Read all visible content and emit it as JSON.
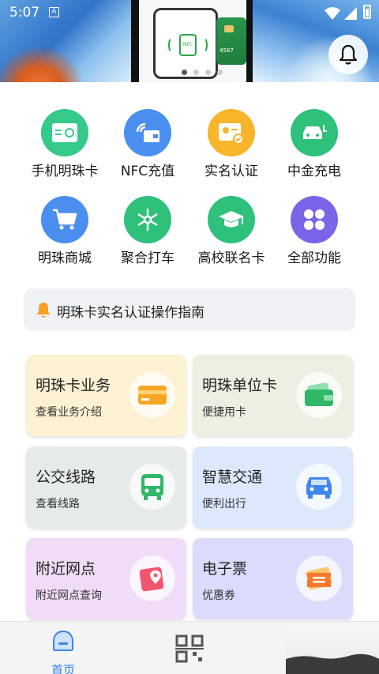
{
  "status_bar": {
    "time": "5:07",
    "badge": "A"
  },
  "banner": {
    "nfc_label": "NFC",
    "card_number": "4587",
    "page_count": 4,
    "active_page": 1
  },
  "quick": [
    {
      "label": "手机明珠卡",
      "icon": "card-icon",
      "color": "#35c98a"
    },
    {
      "label": "NFC充值",
      "icon": "nfc-wallet-icon",
      "color": "#4a8ff0"
    },
    {
      "label": "实名认证",
      "icon": "id-card-icon",
      "color": "#f6b52b"
    },
    {
      "label": "中金充电",
      "icon": "charging-car-icon",
      "color": "#2fc07c"
    },
    {
      "label": "明珠商城",
      "icon": "cart-icon",
      "color": "#4a8ff0"
    },
    {
      "label": "聚合打车",
      "icon": "network-icon",
      "color": "#2fc07c"
    },
    {
      "label": "高校联名卡",
      "icon": "graduation-cap-icon",
      "color": "#2fc07c"
    },
    {
      "label": "全部功能",
      "icon": "all-apps-icon",
      "color": "#7b64e8"
    }
  ],
  "notice": {
    "text": "明珠卡实名认证操作指南"
  },
  "services": [
    {
      "title": "明珠卡业务",
      "sub": "查看业务介绍",
      "icon": "card-icon",
      "bg": "#fdf1d4",
      "icon_color": "#f6a623"
    },
    {
      "title": "明珠单位卡",
      "sub": "便捷用卡",
      "icon": "wallet-icon",
      "bg": "#edefe3",
      "icon_color": "#2fb867"
    },
    {
      "title": "公交线路",
      "sub": "查看线路",
      "icon": "bus-icon",
      "bg": "#e5ebe9",
      "icon_color": "#2fb867"
    },
    {
      "title": "智慧交通",
      "sub": "便利出行",
      "icon": "car-icon",
      "bg": "#dce9fc",
      "icon_color": "#3f86ee"
    },
    {
      "title": "附近网点",
      "sub": "附近网点查询",
      "icon": "map-pin-icon",
      "bg": "#f1dcf7",
      "icon_color": "#f0566f"
    },
    {
      "title": "电子票",
      "sub": "优惠券",
      "icon": "ticket-icon",
      "bg": "#dbdcfb",
      "icon_color": "#f57a2e"
    }
  ],
  "bottom_nav": {
    "home_label": "首页"
  }
}
